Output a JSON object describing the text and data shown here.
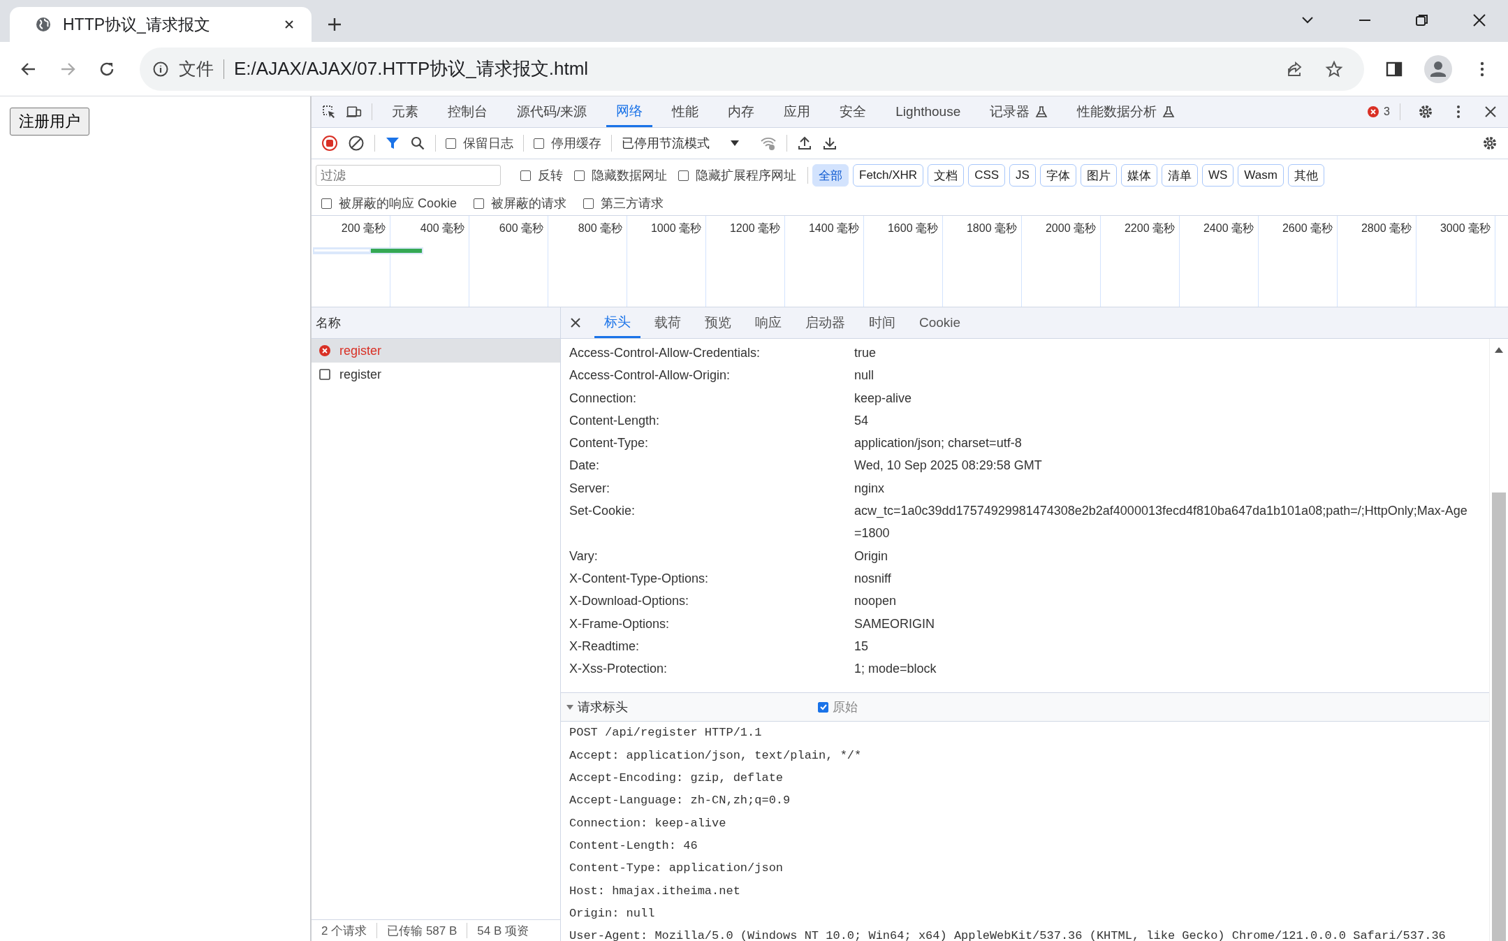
{
  "browser": {
    "tab_title": "HTTP协议_请求报文",
    "address": {
      "scheme_label": "文件",
      "url": "E:/AJAX/AJAX/07.HTTP协议_请求报文.html"
    }
  },
  "page": {
    "button": "注册用户"
  },
  "devtools": {
    "panel_tabs": [
      {
        "label": "元素",
        "selected": false,
        "experimental": false
      },
      {
        "label": "控制台",
        "selected": false,
        "experimental": false
      },
      {
        "label": "源代码/来源",
        "selected": false,
        "experimental": false
      },
      {
        "label": "网络",
        "selected": true,
        "experimental": false
      },
      {
        "label": "性能",
        "selected": false,
        "experimental": false
      },
      {
        "label": "内存",
        "selected": false,
        "experimental": false
      },
      {
        "label": "应用",
        "selected": false,
        "experimental": false
      },
      {
        "label": "安全",
        "selected": false,
        "experimental": false
      },
      {
        "label": "Lighthouse",
        "selected": false,
        "experimental": false
      },
      {
        "label": "记录器",
        "selected": false,
        "experimental": true
      },
      {
        "label": "性能数据分析",
        "selected": false,
        "experimental": true
      }
    ],
    "error_count": "3",
    "toolbar": {
      "recording": true,
      "options": [
        {
          "label": "保留日志",
          "checked": false
        },
        {
          "label": "停用缓存",
          "checked": false
        }
      ],
      "throttle": "已停用节流模式"
    },
    "filter": {
      "placeholder": "过滤",
      "options": [
        {
          "label": "反转",
          "checked": false
        },
        {
          "label": "隐藏数据网址",
          "checked": false
        },
        {
          "label": "隐藏扩展程序网址",
          "checked": false
        }
      ],
      "types": [
        {
          "label": "全部",
          "selected": true
        },
        {
          "label": "Fetch/XHR",
          "selected": false
        },
        {
          "label": "文档",
          "selected": false
        },
        {
          "label": "CSS",
          "selected": false
        },
        {
          "label": "JS",
          "selected": false
        },
        {
          "label": "字体",
          "selected": false
        },
        {
          "label": "图片",
          "selected": false
        },
        {
          "label": "媒体",
          "selected": false
        },
        {
          "label": "清单",
          "selected": false
        },
        {
          "label": "WS",
          "selected": false
        },
        {
          "label": "Wasm",
          "selected": false
        },
        {
          "label": "其他",
          "selected": false
        }
      ],
      "more": [
        {
          "label": "被屏蔽的响应 Cookie",
          "checked": false
        },
        {
          "label": "被屏蔽的请求",
          "checked": false
        },
        {
          "label": "第三方请求",
          "checked": false
        }
      ]
    },
    "timeline_ticks": [
      "200 毫秒",
      "400 毫秒",
      "600 毫秒",
      "800 毫秒",
      "1000 毫秒",
      "1200 毫秒",
      "1400 毫秒",
      "1600 毫秒",
      "1800 毫秒",
      "2000 毫秒",
      "2200 毫秒",
      "2400 毫秒",
      "2600 毫秒",
      "2800 毫秒",
      "3000 毫秒"
    ],
    "requests": {
      "column": "名称",
      "rows": [
        {
          "name": "register",
          "failed": true,
          "selected": true
        },
        {
          "name": "register",
          "failed": false,
          "selected": false
        }
      ]
    },
    "status_bar": [
      "2 个请求",
      "已传输 587 B",
      "54 B 项资"
    ],
    "detail_tabs": [
      {
        "label": "标头",
        "selected": true
      },
      {
        "label": "载荷",
        "selected": false
      },
      {
        "label": "预览",
        "selected": false
      },
      {
        "label": "响应",
        "selected": false
      },
      {
        "label": "启动器",
        "selected": false
      },
      {
        "label": "时间",
        "selected": false
      },
      {
        "label": "Cookie",
        "selected": false
      }
    ],
    "response_headers": [
      {
        "name": "Access-Control-Allow-Credentials:",
        "value": "true"
      },
      {
        "name": "Access-Control-Allow-Origin:",
        "value": "null"
      },
      {
        "name": "Connection:",
        "value": "keep-alive"
      },
      {
        "name": "Content-Length:",
        "value": "54"
      },
      {
        "name": "Content-Type:",
        "value": "application/json; charset=utf-8"
      },
      {
        "name": "Date:",
        "value": "Wed, 10 Sep 2025 08:29:58 GMT"
      },
      {
        "name": "Server:",
        "value": "nginx"
      },
      {
        "name": "Set-Cookie:",
        "value": "acw_tc=1a0c39dd17574929981474308e2b2af4000013fecd4f810ba647da1b101a08;path=/;HttpOnly;Max-Age=1800"
      },
      {
        "name": "Vary:",
        "value": "Origin"
      },
      {
        "name": "X-Content-Type-Options:",
        "value": "nosniff"
      },
      {
        "name": "X-Download-Options:",
        "value": "noopen"
      },
      {
        "name": "X-Frame-Options:",
        "value": "SAMEORIGIN"
      },
      {
        "name": "X-Readtime:",
        "value": "15"
      },
      {
        "name": "X-Xss-Protection:",
        "value": "1; mode=block"
      }
    ],
    "request_headers": {
      "title": "请求标头",
      "expanded": true,
      "raw": {
        "label": "原始",
        "checked": true
      },
      "lines": [
        "POST /api/register HTTP/1.1",
        "Accept: application/json, text/plain, */*",
        "Accept-Encoding: gzip, deflate",
        "Accept-Language: zh-CN,zh;q=0.9",
        "Connection: keep-alive",
        "Content-Length: 46",
        "Content-Type: application/json",
        "Host: hmajax.itheima.net",
        "Origin: null",
        "User-Agent: Mozilla/5.0 (Windows NT 10.0; Win64; x64) AppleWebKit/537.36 (KHTML, like Gecko) Chrome/121.0.0.0 Safari/537.36"
      ]
    }
  }
}
